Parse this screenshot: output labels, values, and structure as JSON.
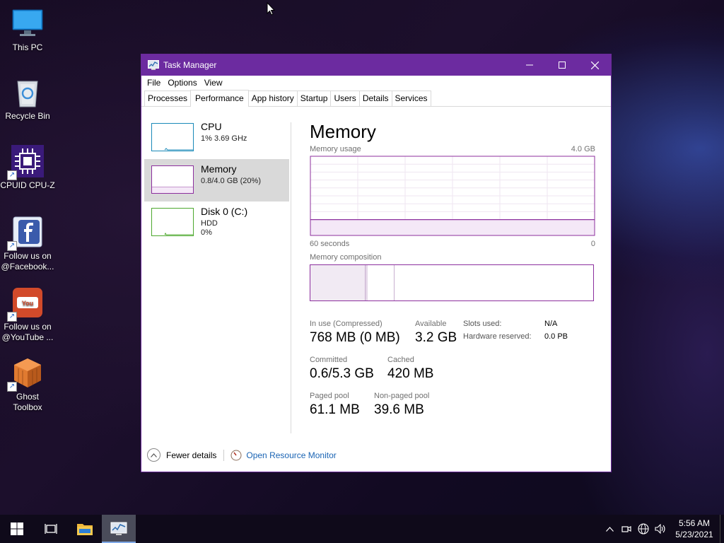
{
  "desktop": {
    "icons": [
      {
        "label": "This PC"
      },
      {
        "label": "Recycle Bin"
      },
      {
        "label": "CPUID CPU-Z"
      },
      {
        "label": "Follow us on\n@Facebook..."
      },
      {
        "label": "Follow us on\n@YouTube ..."
      },
      {
        "label": "Ghost\nToolbox"
      }
    ]
  },
  "window": {
    "title": "Task Manager",
    "titlebar_color": "#6c2ba0",
    "menu": [
      "File",
      "Options",
      "View"
    ],
    "tabs": [
      "Processes",
      "Performance",
      "App history",
      "Startup",
      "Users",
      "Details",
      "Services"
    ],
    "active_tab": "Performance"
  },
  "sidebar": {
    "items": [
      {
        "name": "CPU",
        "line1": "1%  3.69 GHz",
        "line2": "",
        "color": "#1a89b8"
      },
      {
        "name": "Memory",
        "line1": "0.8/4.0 GB (20%)",
        "line2": "",
        "color": "#8c2f9e"
      },
      {
        "name": "Disk 0 (C:)",
        "line1": "HDD",
        "line2": "0%",
        "color": "#4da82e"
      }
    ]
  },
  "memory": {
    "title": "Memory",
    "usage_label": "Memory usage",
    "usage_max": "4.0 GB",
    "time_left": "60 seconds",
    "time_right": "0",
    "composition_label": "Memory composition",
    "in_use_label": "In use (Compressed)",
    "in_use_value": "768 MB (0 MB)",
    "available_label": "Available",
    "available_value": "3.2 GB",
    "slots_label": "Slots used:",
    "slots_value": "N/A",
    "hw_reserved_label": "Hardware reserved:",
    "hw_reserved_value": "0.0 PB",
    "committed_label": "Committed",
    "committed_value": "0.6/5.3 GB",
    "cached_label": "Cached",
    "cached_value": "420 MB",
    "paged_label": "Paged pool",
    "paged_value": "61.1 MB",
    "nonpaged_label": "Non-paged pool",
    "nonpaged_value": "39.6 MB",
    "accent_color": "#8c2f9e"
  },
  "chart_data": {
    "type": "area",
    "title": "Memory usage",
    "ylim": [
      0,
      4.0
    ],
    "x": [
      60,
      0
    ],
    "values": [
      0.8,
      0.8
    ],
    "grid": true
  },
  "footer": {
    "fewer_details": "Fewer details",
    "open_resource_monitor": "Open Resource Monitor"
  },
  "taskbar": {
    "time": "5:56 AM",
    "date": "5/23/2021"
  }
}
